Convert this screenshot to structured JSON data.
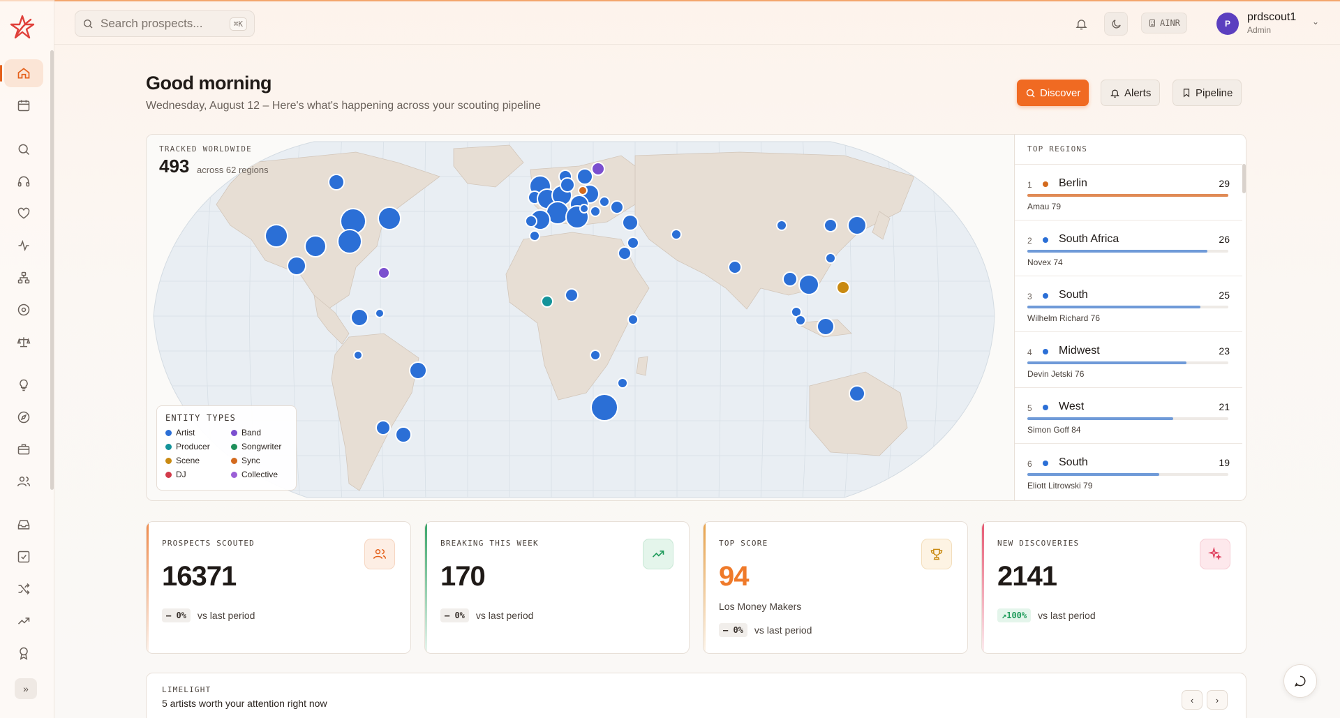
{
  "header": {
    "search_placeholder": "Search prospects...",
    "search_shortcut": "⌘K",
    "currency": "AINR",
    "user": {
      "initial": "P",
      "name": "prdscout1",
      "role": "Admin"
    }
  },
  "page": {
    "greeting": "Good morning",
    "subline": "Wednesday, August 12 – Here's what's happening across your scouting pipeline",
    "actions": {
      "discover": "Discover",
      "alerts": "Alerts",
      "pipeline": "Pipeline"
    }
  },
  "map": {
    "tracked_label": "TRACKED WORLDWIDE",
    "tracked_count": "493",
    "tracked_sub": "across 62 regions",
    "legend_title": "ENTITY TYPES",
    "legend": [
      {
        "label": "Artist",
        "color": "#2b6fd6"
      },
      {
        "label": "Band",
        "color": "#7b4fcf"
      },
      {
        "label": "Producer",
        "color": "#14939a"
      },
      {
        "label": "Songwriter",
        "color": "#1e8f5a"
      },
      {
        "label": "Scene",
        "color": "#c98a12"
      },
      {
        "label": "Sync",
        "color": "#d36a1e"
      },
      {
        "label": "DJ",
        "color": "#d23b4a"
      },
      {
        "label": "Collective",
        "color": "#9b5fd6"
      }
    ]
  },
  "regions": {
    "title": "TOP REGIONS",
    "items": [
      {
        "rank": "1",
        "name": "Berlin",
        "count": "29",
        "top": "Amau 79",
        "color": "#d36a1e",
        "bar_color": "#e08a55",
        "fraction": 1.0
      },
      {
        "rank": "2",
        "name": "South Africa",
        "count": "26",
        "top": "Novex 74",
        "color": "#2b6fd6",
        "bar_color": "#6f9ad8",
        "fraction": 0.897
      },
      {
        "rank": "3",
        "name": "South",
        "count": "25",
        "top": "Wilhelm Richard 76",
        "color": "#2b6fd6",
        "bar_color": "#6f9ad8",
        "fraction": 0.862
      },
      {
        "rank": "4",
        "name": "Midwest",
        "count": "23",
        "top": "Devin Jetski 76",
        "color": "#2b6fd6",
        "bar_color": "#6f9ad8",
        "fraction": 0.793
      },
      {
        "rank": "5",
        "name": "West",
        "count": "21",
        "top": "Simon Goff 84",
        "color": "#2b6fd6",
        "bar_color": "#6f9ad8",
        "fraction": 0.724
      },
      {
        "rank": "6",
        "name": "South",
        "count": "19",
        "top": "Eliott Litrowski 79",
        "color": "#2b6fd6",
        "bar_color": "#6f9ad8",
        "fraction": 0.655
      }
    ]
  },
  "stats": {
    "prospects": {
      "label": "PROSPECTS SCOUTED",
      "value": "16371",
      "delta": "— 0%",
      "vs": "vs last period",
      "accent": "#f08a4a"
    },
    "breaking": {
      "label": "BREAKING THIS WEEK",
      "value": "170",
      "delta": "— 0%",
      "vs": "vs last period",
      "accent": "#3aa56a"
    },
    "top_score": {
      "label": "TOP SCORE",
      "value": "94",
      "sub": "Los Money Makers",
      "delta": "— 0%",
      "vs": "vs last period",
      "accent": "#e8a24a"
    },
    "new_discoveries": {
      "label": "NEW DISCOVERIES",
      "value": "2141",
      "delta": "↗100%",
      "vs": "vs last period",
      "accent": "#e65a74"
    }
  },
  "limelight": {
    "label": "LIMELIGHT",
    "sub": "5 artists worth your attention right now"
  }
}
